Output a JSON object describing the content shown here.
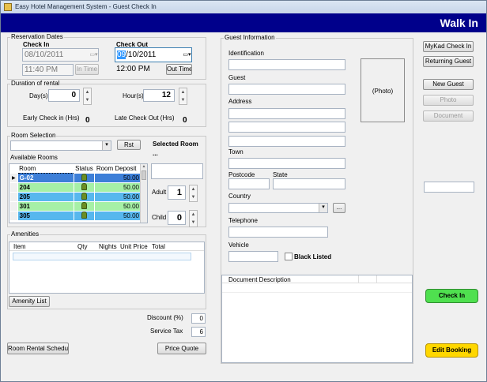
{
  "title": "Easy Hotel Management System - Guest Check In",
  "banner": "Walk In",
  "reservation": {
    "group_label": "Reservation Dates",
    "checkin_label": "Check In",
    "checkin_date": "08/10/2011",
    "checkin_time": "11:40 PM",
    "in_time_btn": "In Time",
    "checkout_label": "Check Out",
    "checkout_date_sel": "09",
    "checkout_date_rest": "/10/2011",
    "checkout_time": "12:00 PM",
    "out_time_btn": "Out Time"
  },
  "duration": {
    "group_label": "Duration of rental",
    "days_label": "Day(s)",
    "days": "0",
    "hours_label": "Hour(s)",
    "hours": "12",
    "early_label": "Early Check in (Hrs)",
    "early": "0",
    "late_label": "Late Check Out (Hrs)",
    "late": "0"
  },
  "room": {
    "selection_label": "Room Selection",
    "rst_btn": "Rst",
    "selected_label": "Selected Room",
    "selected_value": "...",
    "available_label": "Available Rooms",
    "cols": [
      "Room",
      "Status",
      "Room Deposit"
    ],
    "rows": [
      {
        "room": "G-02",
        "deposit": "50.00",
        "color": "#3d7fd8"
      },
      {
        "room": "204",
        "deposit": "50.00",
        "color": "#a6f0a6"
      },
      {
        "room": "205",
        "deposit": "50.00",
        "color": "#57b7ee"
      },
      {
        "room": "301",
        "deposit": "50.00",
        "color": "#a6f0a6"
      },
      {
        "room": "305",
        "deposit": "50.00",
        "color": "#57b7ee"
      }
    ],
    "adult_label": "Adult",
    "adult": "1",
    "child_label": "Child",
    "child": "0"
  },
  "amenities": {
    "group_label": "Amenities",
    "cols": [
      "Item",
      "Qty",
      "Nights",
      "Unit Price",
      "Total"
    ],
    "list_btn": "Amenity List",
    "discount_label": "Discount (%)",
    "discount": "0",
    "tax_label": "Service Tax",
    "tax": "6",
    "schedule_btn": "Room Rental Schedule",
    "quote_btn": "Price Quote"
  },
  "guest": {
    "group_label": "Guest Information",
    "identification": "Identification",
    "guest": "Guest",
    "address": "Address",
    "town": "Town",
    "postcode": "Postcode",
    "state": "State",
    "country": "Country",
    "ellipsis_btn": "...",
    "telephone": "Telephone",
    "vehicle": "Vehicle",
    "blacklisted": "Black Listed",
    "photo": "(Photo)",
    "doc_col": "Document Description"
  },
  "side": {
    "mykad_btn": "MyKad Check In",
    "returning_btn": "Returning Guest",
    "new_btn": "New Guest",
    "photo_btn": "Photo",
    "document_btn": "Document",
    "checkin_btn": "Check In",
    "edit_btn": "Edit Booking",
    "checkin_color": "#4fe04f",
    "edit_color": "#ffd700"
  }
}
